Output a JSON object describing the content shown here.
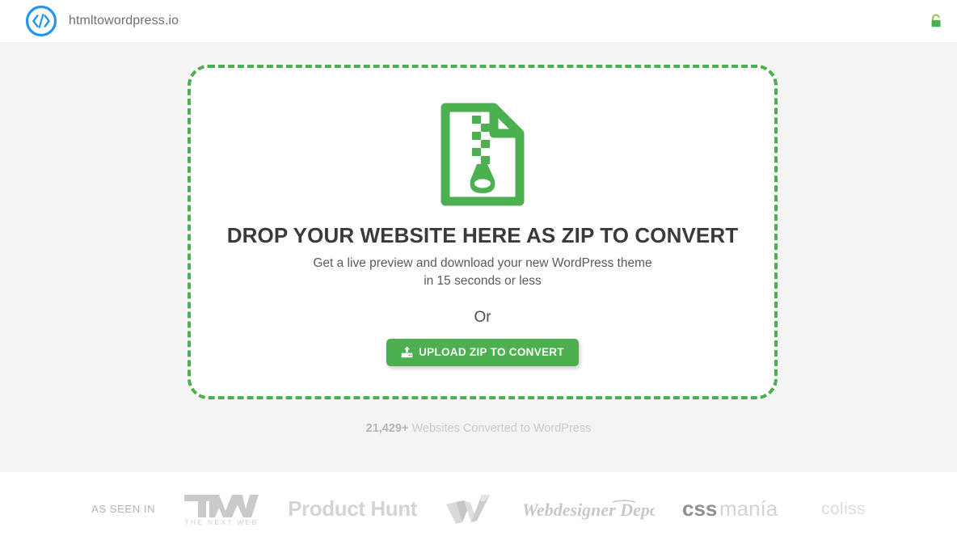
{
  "header": {
    "brand_name": "htmltowordpress.io",
    "logo_icon": "code-brackets-circle-icon",
    "logo_color": "#2196f3",
    "lock_icon": "green-padlock-icon",
    "lock_color": "#4caf50"
  },
  "dropzone": {
    "file_icon": "zip-file-icon",
    "file_icon_color": "#4caf50",
    "title": "DROP YOUR WEBSITE HERE AS ZIP TO CONVERT",
    "subtitle_line1": "Get a live preview and download your new WordPress theme",
    "subtitle_line2": "in 15 seconds or less",
    "or_label": "Or",
    "upload_button_label": "UPLOAD ZIP TO CONVERT",
    "upload_button_icon": "upload-icon",
    "accent_color": "#4caf50"
  },
  "counter": {
    "count": "21,429+",
    "text": " Websites Converted to WordPress"
  },
  "footer": {
    "as_seen_in_label": "AS SEEN IN",
    "logos": [
      {
        "name": "tnw",
        "label": "TNW",
        "sublabel": "THE NEXT WEB"
      },
      {
        "name": "product-hunt",
        "label": "Product Hunt"
      },
      {
        "name": "w-ribbon",
        "label": "W"
      },
      {
        "name": "webdesigner-depot",
        "label": "Webdesigner Depot"
      },
      {
        "name": "cssmania",
        "label_bold": "css",
        "label_light": "manía"
      },
      {
        "name": "coliss",
        "label": "coliss"
      }
    ]
  }
}
